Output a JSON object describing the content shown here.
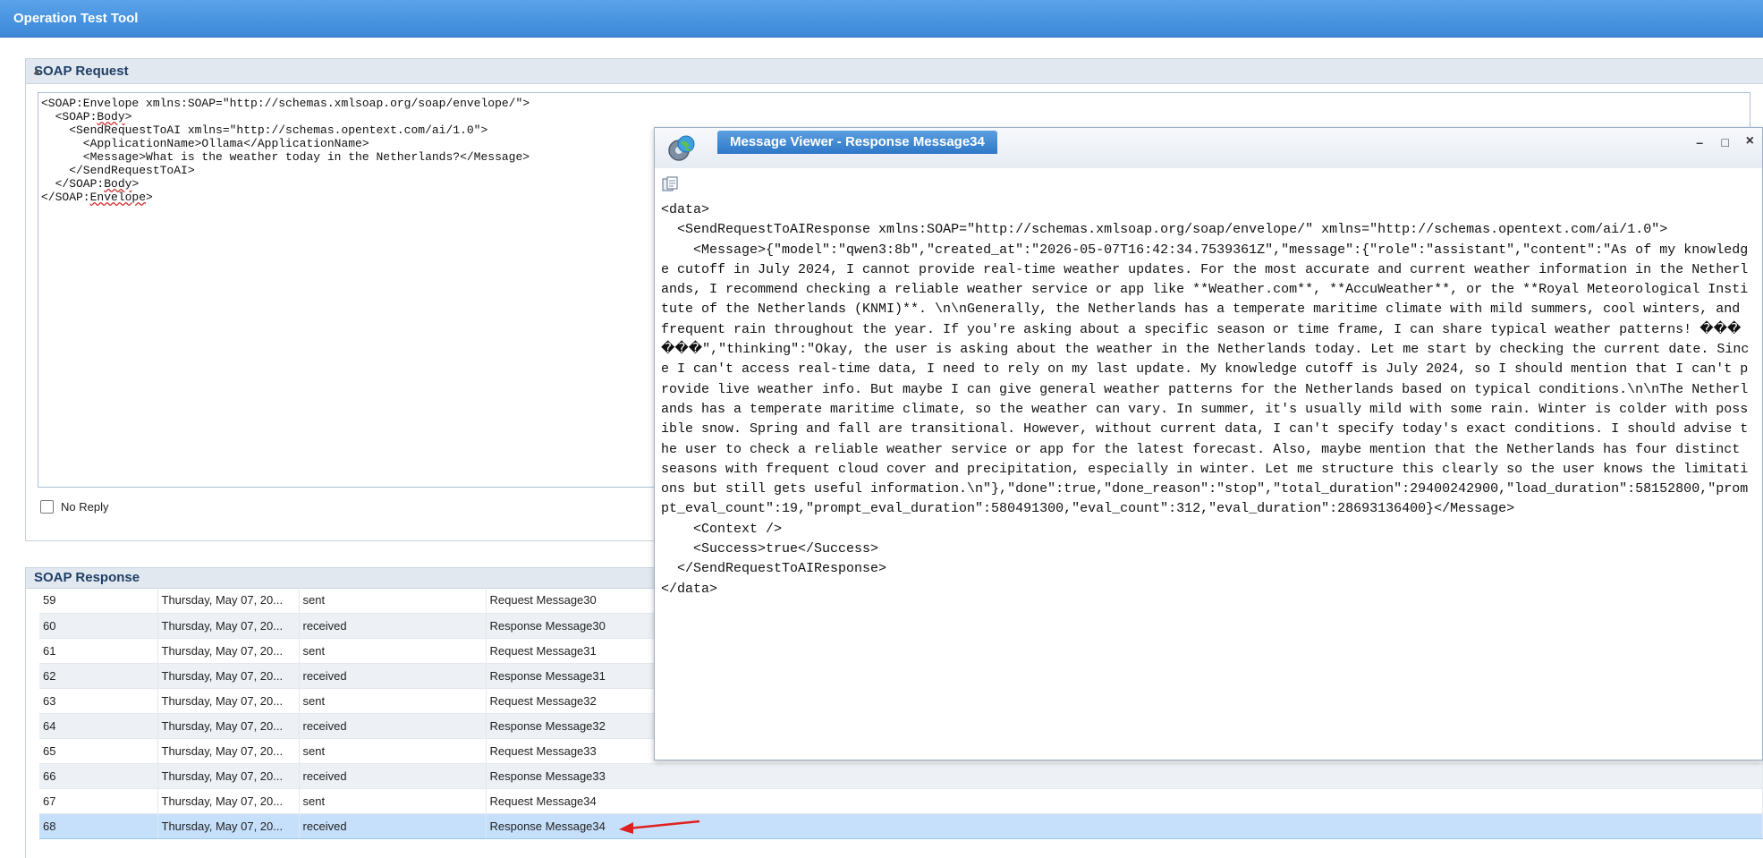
{
  "app": {
    "title": "Operation Test Tool"
  },
  "request_panel": {
    "header": "SOAP Request",
    "xml": {
      "line1": "<SOAP:Envelope xmlns:SOAP=\"http://schemas.xmlsoap.org/soap/envelope/\">",
      "line2_pre": "  <SOAP:",
      "line2_word": "Body",
      "line2_post": ">",
      "line3": "    <SendRequestToAI xmlns=\"http://schemas.opentext.com/ai/1.0\">",
      "line4": "      <ApplicationName>Ollama</ApplicationName>",
      "line5": "      <Message>What is the weather today in the Netherlands?</Message>",
      "line6": "    </SendRequestToAI>",
      "line7_pre": "  </SOAP:",
      "line7_word": "Body",
      "line7_post": ">",
      "line8_pre": "</SOAP:",
      "line8_word": "Envelope",
      "line8_post": ">"
    },
    "no_reply_label": "No Reply"
  },
  "response_panel": {
    "header": "SOAP Response",
    "rows": [
      {
        "num": "59",
        "date": "Thursday, May 07, 20...",
        "direction": "sent",
        "message": "Request Message30"
      },
      {
        "num": "60",
        "date": "Thursday, May 07, 20...",
        "direction": "received",
        "message": "Response Message30"
      },
      {
        "num": "61",
        "date": "Thursday, May 07, 20...",
        "direction": "sent",
        "message": "Request Message31"
      },
      {
        "num": "62",
        "date": "Thursday, May 07, 20...",
        "direction": "received",
        "message": "Response Message31"
      },
      {
        "num": "63",
        "date": "Thursday, May 07, 20...",
        "direction": "sent",
        "message": "Request Message32"
      },
      {
        "num": "64",
        "date": "Thursday, May 07, 20...",
        "direction": "received",
        "message": "Response Message32"
      },
      {
        "num": "65",
        "date": "Thursday, May 07, 20...",
        "direction": "sent",
        "message": "Request Message33"
      },
      {
        "num": "66",
        "date": "Thursday, May 07, 20...",
        "direction": "received",
        "message": "Response Message33"
      },
      {
        "num": "67",
        "date": "Thursday, May 07, 20...",
        "direction": "sent",
        "message": "Request Message34"
      },
      {
        "num": "68",
        "date": "Thursday, May 07, 20...",
        "direction": "received",
        "message": "Response Message34"
      }
    ]
  },
  "message_viewer": {
    "title": "Message Viewer - Response Message34",
    "controls": {
      "minimize": "–",
      "maximize": "□",
      "close": "×"
    },
    "lines": {
      "l1": "<data>",
      "l2": "  <SendRequestToAIResponse xmlns:SOAP=\"http://schemas.xmlsoap.org/soap/envelope/\" xmlns=\"http://schemas.opentext.com/ai/1.0\">",
      "l3": "    <Message>{\"model\":\"qwen3:8b\",\"created_at\":\"2026-05-07T16:42:34.7539361Z\",\"message\":{\"role\":\"assistant\",\"content\":\"As of my knowledge cutoff in July 2024, I cannot provide real-time weather updates. For the most accurate and current weather information in the Netherlands, I recommend checking a reliable weather service or app like **Weather.com**, **AccuWeather**, or the **Royal Meteorological Institute of the Netherlands (KNMI)**. \\n\\nGenerally, the Netherlands has a temperate maritime climate with mild summers, cool winters, and frequent rain throughout the year. If you're asking about a specific season or time frame, I can share typical weather patterns! ������\",\"thinking\":\"Okay, the user is asking about the weather in the Netherlands today. Let me start by checking the current date. Since I can't access real-time data, I need to rely on my last update. My knowledge cutoff is July 2024, so I should mention that I can't provide live weather info. But maybe I can give general weather patterns for the Netherlands based on typical conditions.\\n\\nThe Netherlands has a temperate maritime climate, so the weather can vary. In summer, it's usually mild with some rain. Winter is colder with possible snow. Spring and fall are transitional. However, without current data, I can't specify today's exact conditions. I should advise the user to check a reliable weather service or app for the latest forecast. Also, maybe mention that the Netherlands has four distinct seasons with frequent cloud cover and precipitation, especially in winter. Let me structure this clearly so the user knows the limitations but still gets useful information.\\n\"},\"done\":true,\"done_reason\":\"stop\",\"total_duration\":29400242900,\"load_duration\":58152800,\"prompt_eval_count\":19,\"prompt_eval_duration\":580491300,\"eval_count\":312,\"eval_duration\":28693136400}</Message>",
      "l4": "    <Context />",
      "l5": "    <Success>true</Success>",
      "l6": "  </SendRequestToAIResponse>",
      "l7": "</data>"
    }
  },
  "colors": {
    "titlebar": "#3c88d8",
    "selected_row": "#c6e0fb",
    "arrow": "#e02020"
  }
}
